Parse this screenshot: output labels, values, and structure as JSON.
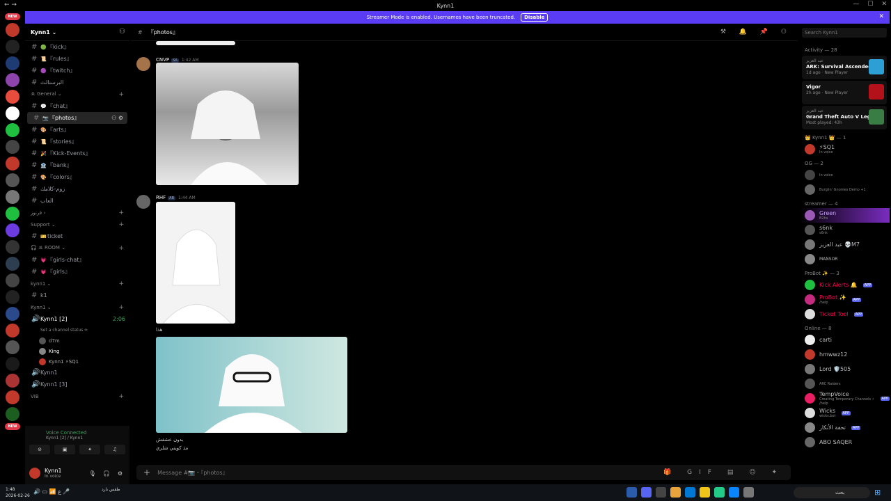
{
  "window": {
    "title": "Kynn1"
  },
  "banner": {
    "text": "Streamer Mode is enabled. Usernames have been truncated.",
    "button": "Disable"
  },
  "guild": {
    "name": "Kynn1 ⌄"
  },
  "channels": [
    {
      "label": "『kick』",
      "emoji": "🟢"
    },
    {
      "label": "『rules』",
      "emoji": "📜"
    },
    {
      "label": "『twitch』",
      "emoji": "🟣"
    },
    {
      "label": "البرسنالث",
      "emoji": ""
    }
  ],
  "cat_general": "ꔛ General ⌄",
  "channels2": [
    {
      "label": "『chat』",
      "emoji": "💬"
    },
    {
      "label": "『photos』",
      "emoji": "📷",
      "active": true
    },
    {
      "label": "『arts』",
      "emoji": "🎨"
    },
    {
      "label": "『stories』",
      "emoji": "📜"
    },
    {
      "label": "『Kick-Events』",
      "emoji": "🎉"
    },
    {
      "label": "『bank』",
      "emoji": "🏦"
    },
    {
      "label": "『colors』",
      "emoji": "🎨"
    },
    {
      "label": "زوم-كلامك",
      "emoji": ""
    },
    {
      "label": "العاب",
      "emoji": ""
    }
  ],
  "cat_trix": "قرنوز ›",
  "cat_support": "Support ⌄",
  "ch_ticket": "ticket",
  "cat_room": "🎧 ꔛ ROOM ⌄",
  "ch_girlschat": "『girls-chat』",
  "ch_girls": "『girls』",
  "cat_kynn1a": "kynn1 ⌄",
  "ch_k1": "k1",
  "cat_kynn1b": "Kynn1 ⌄",
  "voice": {
    "name": "Kynn1 [2]",
    "status": "Set a channel status ✏",
    "time": "2:06",
    "users": [
      "d7m",
      "King",
      "Kynn1 ⚡SQ1"
    ]
  },
  "voice2": "Kynn1",
  "voice3": "Kynn1 [3]",
  "cat_vib": "VIB",
  "panel": {
    "vc": "Voice Connected",
    "vc_sub": "Kynn1 [2] / Kynn1",
    "user": "Kynn1",
    "user_status": "In voice"
  },
  "header": {
    "channel": "『photos』"
  },
  "messages": [
    {
      "author": "CNVP",
      "tag": "SA",
      "time": "1:42 AM"
    },
    {
      "author": "RHF",
      "tag": "AB",
      "time": "1:44 AM",
      "caption": "هذا"
    },
    {
      "caption1": "بدون عشقش",
      "caption2": "مذ كويتي شلري"
    }
  ],
  "composer": {
    "placeholder": "Message #📷・『photos』"
  },
  "search": {
    "placeholder": "Search Kynn1"
  },
  "activity": {
    "title": "Activity — 28",
    "items": [
      {
        "who": "عبد العزيز",
        "game": "ARK: Survival Ascended",
        "meta": "1d ago · New Player",
        "color": "#2e9fd4"
      },
      {
        "who": "",
        "game": "Vigor",
        "meta": "2h ago · New Player",
        "color": "#b3121b"
      },
      {
        "who": "عبد العزيز",
        "game": "Grand Theft Auto V Legacy",
        "meta": "Most played: 43h",
        "color": "#3a7d44"
      }
    ]
  },
  "groups": [
    {
      "title": "👑 Kynn1 👑 — 1",
      "members": [
        {
          "name": "⚡SQ1",
          "sub": "In voice",
          "color": "#c0392b"
        }
      ]
    },
    {
      "title": "OG — 2",
      "members": [
        {
          "name": "",
          "sub": "In voice",
          "color": "#444"
        },
        {
          "name": "",
          "sub": "Burglin' Gnomes Demo +1",
          "color": "#666"
        }
      ]
    },
    {
      "title": "streamer — 4",
      "members": [
        {
          "name": "Green",
          "sub": "B2hs",
          "color": "#9b59b6"
        },
        {
          "name": "s6nk",
          "sub": "s6nk",
          "color": "#555"
        },
        {
          "name": "عبد العزيز 💀M7",
          "sub": "",
          "color": "#777"
        },
        {
          "name": "MANSOR",
          "sub": "",
          "color": "#888"
        }
      ]
    },
    {
      "title": "ProBot ✨ — 3",
      "members": [
        {
          "name": "Kick Alerts 🔔",
          "sub": "",
          "color": "#1fbf3f",
          "app": "APP"
        },
        {
          "name": "ProBot ✨",
          "sub": "/help",
          "color": "#c42b7f",
          "app": "APP"
        },
        {
          "name": "Ticket Tool",
          "sub": "",
          "color": "#ddd",
          "app": "APP"
        }
      ]
    },
    {
      "title": "Online — 8",
      "members": [
        {
          "name": "carti",
          "sub": "",
          "color": "#eee"
        },
        {
          "name": "hmwwz12",
          "sub": "",
          "color": "#c0392b"
        },
        {
          "name": "Lord 🛡️505",
          "sub": "",
          "color": "#777"
        },
        {
          "name": "",
          "sub": "ARC Raiders",
          "color": "#555"
        },
        {
          "name": "TempVoice",
          "sub": "Creating Temporary Channels • /help",
          "color": "#e91e63",
          "app": "APP"
        },
        {
          "name": "Wicks",
          "sub": "wicks.bot",
          "color": "#ddd",
          "app": "APP"
        },
        {
          "name": "تحفة الأنكار",
          "sub": "",
          "color": "#888",
          "app": "APP"
        },
        {
          "name": "ABO SAQER",
          "sub": "",
          "color": "#666"
        }
      ]
    }
  ],
  "taskbar": {
    "time": "1:48",
    "date": "2026-02-26",
    "weather": "طقس بارد",
    "search": "بحث",
    "lang": "ع"
  }
}
